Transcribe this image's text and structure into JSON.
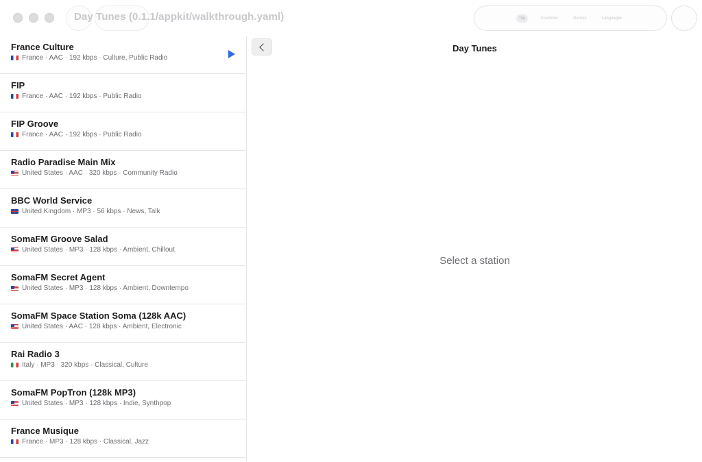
{
  "window": {
    "title": "Day Tunes (0.1.1/appkit/walkthrough.yaml)"
  },
  "toolbar": {
    "segments": [
      {
        "label": "Top",
        "active": true
      },
      {
        "label": "Countries",
        "active": false
      },
      {
        "label": "Genres",
        "active": false
      },
      {
        "label": "Languages",
        "active": false
      }
    ]
  },
  "sidebar": {
    "stations": [
      {
        "name": "France Culture",
        "flag": "fr",
        "meta": "France · AAC · 192 kbps · Culture, Public Radio",
        "playing": true
      },
      {
        "name": "FIP",
        "flag": "fr",
        "meta": "France · AAC · 192 kbps · Public Radio",
        "playing": false
      },
      {
        "name": "FIP Groove",
        "flag": "fr",
        "meta": "France · AAC · 192 kbps · Public Radio",
        "playing": false
      },
      {
        "name": "Radio Paradise Main Mix",
        "flag": "us",
        "meta": "United States · AAC · 320 kbps · Community Radio",
        "playing": false
      },
      {
        "name": "BBC World Service",
        "flag": "gb",
        "meta": "United Kingdom · MP3 · 56 kbps · News, Talk",
        "playing": false
      },
      {
        "name": "SomaFM Groove Salad",
        "flag": "us",
        "meta": "United States · MP3 · 128 kbps · Ambient, Chillout",
        "playing": false
      },
      {
        "name": "SomaFM Secret Agent",
        "flag": "us",
        "meta": "United States · MP3 · 128 kbps · Ambient, Downtempo",
        "playing": false
      },
      {
        "name": "SomaFM Space Station Soma (128k AAC)",
        "flag": "us",
        "meta": "United States · AAC · 128 kbps · Ambient, Electronic",
        "playing": false
      },
      {
        "name": "Rai Radio 3",
        "flag": "it",
        "meta": "Italy · MP3 · 320 kbps · Classical, Culture",
        "playing": false
      },
      {
        "name": "SomaFM PopTron (128k MP3)",
        "flag": "us",
        "meta": "United States · MP3 · 128 kbps · Indie, Synthpop",
        "playing": false
      },
      {
        "name": "France Musique",
        "flag": "fr",
        "meta": "France · MP3 · 128 kbps · Classical, Jazz",
        "playing": false
      }
    ]
  },
  "detail": {
    "title": "Day Tunes",
    "empty_message": "Select a station"
  },
  "colors": {
    "accent": "#2f6ee6"
  }
}
